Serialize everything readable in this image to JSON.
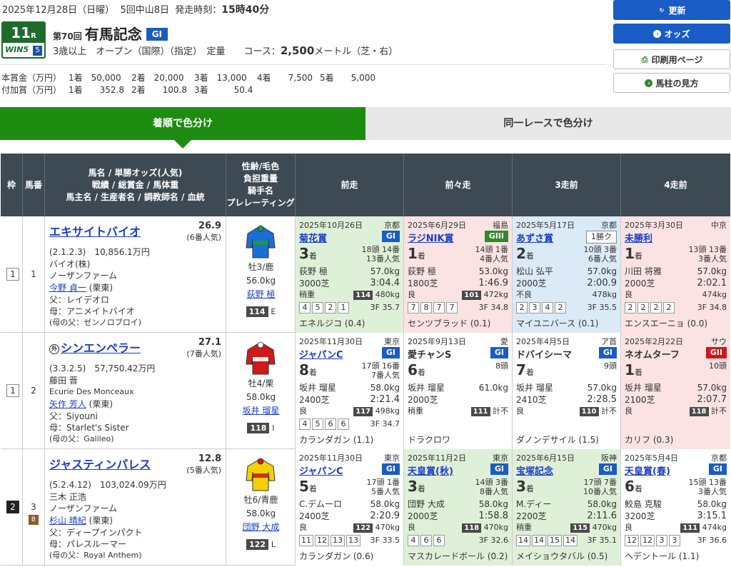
{
  "header": {
    "date": "2025年12月28日（日曜）",
    "meet": "5回中山8日",
    "post_label": "発走時刻：",
    "post_time": "15時40分",
    "race_no": "11",
    "race_no_suffix": "R",
    "win5_label": "WIN5",
    "win5_num": "5",
    "ordinal": "第70回",
    "race_name": "有馬記念",
    "grade": "GI",
    "conditions": "3歳以上　オープン（国際）（指定）　定量　　コース：",
    "distance": "2,500",
    "dist_unit": "メートル（芝・右）",
    "prize_label": "本賞金（万円）",
    "prize": [
      "1着　50,000",
      "2着　20,000",
      "3着　13,000",
      "4着　　7,500",
      "5着　　5,000"
    ],
    "add_label": "付加賞（万円）",
    "add": [
      "1着　　352.8",
      "2着　　100.8",
      "3着　　　50.4"
    ]
  },
  "buttons": {
    "refresh": "更新",
    "odds": "オッズ",
    "print": "印刷用ページ",
    "guide": "馬柱の見方"
  },
  "tabs": {
    "t1": "着順で色分け",
    "t2": "同一レースで色分け"
  },
  "columns": {
    "waku": "枠",
    "umaban": "馬番",
    "horse": "馬名 / 単勝オッズ(人気)\n戦績 / 総賞金 / 馬体重\n馬主名 / 生産者名 / 調教師名 / 血統",
    "jockey": "性齢/毛色\n負担重量\n騎手名\nプレレーティング",
    "p1": "前走",
    "p2": "前々走",
    "p3": "3走前",
    "p4": "4走前"
  },
  "horses": [
    {
      "waku": "1",
      "umaban": "1",
      "name": "エキサイトバイオ",
      "odds": "26.9",
      "pop": "(6番人気)",
      "record": "(2.1.2.3)　10,856.1万円",
      "owner": "バイオ(株)",
      "breeder": "ノーザンファーム",
      "trainer": "今野 貞一",
      "area": "(栗東)",
      "sire": "父：レイデオロ",
      "dam": "母：アニメイトバイオ",
      "damsire": "(母の父：ゼンノロブロイ)",
      "sex": "牡3/鹿",
      "weight": "56.0kg",
      "jockey": "荻野 極",
      "rating": "114",
      "rate_grade": "E",
      "past": [
        {
          "date": "2025年10月26日",
          "venue": "京都",
          "race": "菊花賞",
          "grade": "GI",
          "gc": "g1",
          "rank": "3",
          "field": "18頭 14番",
          "pop": "13番人気",
          "jockey": "荻野 極",
          "wt": "57.0kg",
          "course": "3000芝",
          "time": "3:04.4",
          "cond": "稍重",
          "rate": "114",
          "bw": "480kg",
          "corners": [
            "4",
            "5",
            "2",
            "1"
          ],
          "f3": "3F 35.7",
          "winner": "エネルジコ (0.4)",
          "bg": "p-green"
        },
        {
          "date": "2025年6月29日",
          "venue": "福島",
          "race": "ラジNIK賞",
          "grade": "GIII",
          "gc": "g3",
          "rank": "1",
          "field": "14頭 1番",
          "pop": "4番人気",
          "jockey": "荻野 極",
          "wt": "53.0kg",
          "course": "1800芝",
          "time": "1:46.9",
          "cond": "良",
          "rate": "101",
          "bw": "472kg",
          "corners": [
            "7",
            "8",
            "7",
            "7"
          ],
          "f3": "3F 34.8",
          "winner": "センツブラッド (0.1)",
          "bg": "p-pink"
        },
        {
          "date": "2025年5月17日",
          "venue": "京都",
          "race": "あずさ賞",
          "grade": "1勝ク",
          "gc": "cls",
          "rank": "2",
          "field": "10頭 3番",
          "pop": "6番人気",
          "jockey": "松山 弘平",
          "wt": "57.0kg",
          "course": "2000芝",
          "time": "2:00.9",
          "cond": "不良",
          "rate": "",
          "bw": "478kg",
          "corners": [
            "2",
            "3",
            "4",
            "2"
          ],
          "f3": "3F 35.5",
          "winner": "マイユニバース (0.1)",
          "bg": "p-blue"
        },
        {
          "date": "2025年3月30日",
          "venue": "中京",
          "race": "未勝利",
          "grade": "",
          "gc": "",
          "rank": "1",
          "field": "13頭 13番",
          "pop": "3番人気",
          "jockey": "川田 将雅",
          "wt": "57.0kg",
          "course": "2000芝",
          "time": "2:02.1",
          "cond": "良",
          "rate": "",
          "bw": "474kg",
          "corners": [
            "2",
            "2",
            "2",
            "2"
          ],
          "f3": "3F 34.8",
          "winner": "エンスエーニョ (0.0)",
          "bg": "p-pink"
        }
      ]
    },
    {
      "waku": "1",
      "umaban": "2",
      "name": "シンエンペラー",
      "foreign": "外",
      "odds": "27.1",
      "pop": "(7番人気)",
      "record": "(3.3.2.5)　57,750.42万円",
      "owner": "藤田 晋",
      "breeder": "Ecurie Des Monceaux",
      "trainer": "矢作 芳人",
      "area": "(栗東)",
      "sire": "父：Siyouni",
      "dam": "母：Starlet's Sister",
      "damsire": "(母の父：Galileo)",
      "sex": "牡4/栗",
      "weight": "58.0kg",
      "jockey": "坂井 瑠星",
      "rating": "118",
      "rate_grade": "I",
      "past": [
        {
          "date": "2025年11月30日",
          "venue": "東京",
          "race": "ジャパンC",
          "grade": "GI",
          "gc": "g1",
          "rank": "8",
          "field": "17頭 16番",
          "pop": "7番人気",
          "jockey": "坂井 瑠星",
          "wt": "58.0kg",
          "course": "2400芝",
          "time": "2:21.4",
          "cond": "良",
          "rate": "117",
          "bw": "498kg",
          "corners": [
            "4",
            "5",
            "6",
            "6"
          ],
          "f3": "3F 34.7",
          "winner": "カランダガン (1.1)",
          "bg": "p-white"
        },
        {
          "date": "2025年9月13日",
          "venue": "愛",
          "race": "愛チャンS",
          "grade": "GI",
          "gc": "g1",
          "rank": "6",
          "field": "8頭",
          "pop": "",
          "jockey": "坂井 瑠星",
          "wt": "61.0kg",
          "course": "2000芝",
          "time": "",
          "cond": "稍重",
          "rate": "111",
          "bw": "計不",
          "corners": [],
          "f3": "",
          "winner": "ドラクロワ",
          "bg": "p-white"
        },
        {
          "date": "2025年4月5日",
          "venue": "ア首",
          "race": "ドバイシーマ",
          "grade": "GI",
          "gc": "g1",
          "rank": "7",
          "field": "9頭",
          "pop": "",
          "jockey": "坂井 瑠星",
          "wt": "57.0kg",
          "course": "2410芝",
          "time": "2:28.5",
          "cond": "良",
          "rate": "110",
          "bw": "計不",
          "corners": [],
          "f3": "",
          "winner": "ダノンデサイル (1.5)",
          "bg": "p-white"
        },
        {
          "date": "2025年2月22日",
          "venue": "サウ",
          "race": "ネオムターフ",
          "grade": "GII",
          "gc": "g2",
          "rank": "1",
          "field": "10頭",
          "pop": "",
          "jockey": "坂井 瑠星",
          "wt": "57.0kg",
          "course": "2100芝",
          "time": "2:07.7",
          "cond": "良",
          "rate": "118",
          "bw": "計不",
          "corners": [],
          "f3": "",
          "winner": "カリフ (0.3)",
          "bg": "p-pink"
        }
      ]
    },
    {
      "waku": "2",
      "umaban": "3",
      "blinker": "B",
      "name": "ジャスティンパレス",
      "odds": "12.8",
      "pop": "(5番人気)",
      "record": "(5.2.4.12)　103,024.09万円",
      "owner": "三木 正浩",
      "breeder": "ノーザンファーム",
      "trainer": "杉山 晴紀",
      "area": "(栗東)",
      "sire": "父：ディープインパクト",
      "dam": "母：パレスルーマー",
      "damsire": "(母の父：Royal Anthem)",
      "sex": "牡6/青鹿",
      "weight": "58.0kg",
      "jockey": "団野 大成",
      "rating": "122",
      "rate_grade": "L",
      "past": [
        {
          "date": "2025年11月30日",
          "venue": "東京",
          "race": "ジャパンC",
          "grade": "GI",
          "gc": "g1",
          "rank": "5",
          "field": "17頭 1番",
          "pop": "5番人気",
          "jockey": "C.デムーロ",
          "wt": "58.0kg",
          "course": "2400芝",
          "time": "2:20.9",
          "cond": "良",
          "rate": "122",
          "bw": "470kg",
          "corners": [
            "11",
            "12",
            "13",
            "13"
          ],
          "f3": "3F 33.5",
          "winner": "カランダガン (0.6)",
          "bg": "p-white"
        },
        {
          "date": "2025年11月2日",
          "venue": "東京",
          "race": "天皇賞(秋)",
          "grade": "GI",
          "gc": "g1",
          "rank": "3",
          "field": "14頭 3番",
          "pop": "8番人気",
          "jockey": "団野 大成",
          "wt": "58.0kg",
          "course": "2000芝",
          "time": "1:58.8",
          "cond": "良",
          "rate": "118",
          "bw": "470kg",
          "corners": [
            "4",
            "6",
            "6"
          ],
          "f3": "3F 32.6",
          "winner": "マスカレードボール (0.2)",
          "bg": "p-green"
        },
        {
          "date": "2025年6月15日",
          "venue": "阪神",
          "race": "宝塚記念",
          "grade": "GI",
          "gc": "g1",
          "rank": "3",
          "field": "17頭 7番",
          "pop": "10番人気",
          "jockey": "M.ディー",
          "wt": "58.0kg",
          "course": "2200芝",
          "time": "2:11.6",
          "cond": "稍重",
          "rate": "115",
          "bw": "470kg",
          "corners": [
            "14",
            "14",
            "15",
            "14"
          ],
          "f3": "3F 35.1",
          "winner": "メイショウタバル (0.5)",
          "bg": "p-green"
        },
        {
          "date": "2025年5月4日",
          "venue": "京都",
          "race": "天皇賞(春)",
          "grade": "GI",
          "gc": "g1",
          "rank": "6",
          "field": "15頭 13番",
          "pop": "3番人気",
          "jockey": "鮫島 克駿",
          "wt": "58.0kg",
          "course": "3200芝",
          "time": "3:15.1",
          "cond": "良",
          "rate": "111",
          "bw": "474kg",
          "corners": [
            "12",
            "12",
            "3",
            "3"
          ],
          "f3": "3F 36.6",
          "winner": "ヘデントール (1.1)",
          "bg": "p-white"
        }
      ]
    }
  ]
}
